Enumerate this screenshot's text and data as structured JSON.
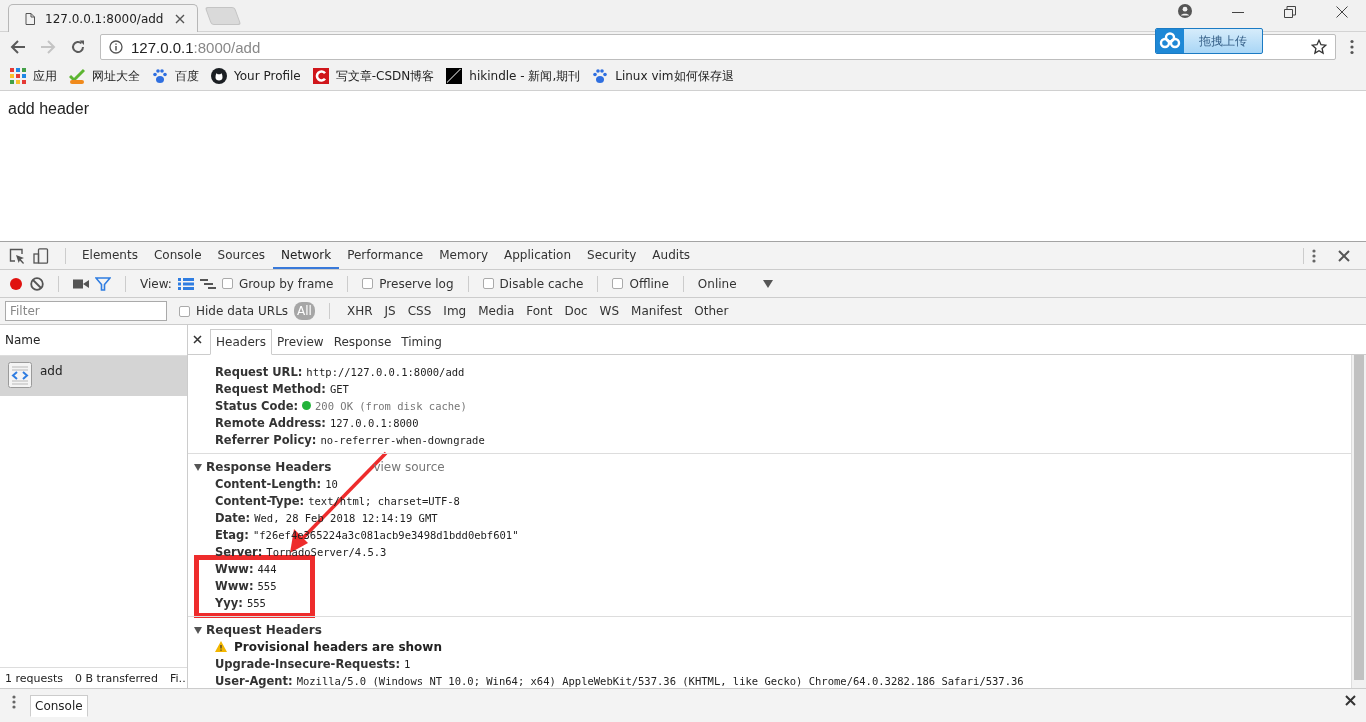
{
  "browser": {
    "tabs": [
      {
        "title": "127.0.0.1:8000/add",
        "selected": true
      }
    ],
    "address": {
      "host": "127.0.0.1",
      "path": ":8000/add"
    },
    "extension_button": "拖拽上传",
    "bookmarks": [
      {
        "label": "应用",
        "kind": "apps"
      },
      {
        "label": "网址大全",
        "kind": "check"
      },
      {
        "label": "百度",
        "kind": "paw"
      },
      {
        "label": "Your Profile",
        "kind": "cat"
      },
      {
        "label": "写文章-CSDN博客",
        "kind": "c"
      },
      {
        "label": "hikindle - 新闻,期刊",
        "kind": "split"
      },
      {
        "label": "Linux vim如何保存退",
        "kind": "paw"
      }
    ]
  },
  "page": {
    "text": "add header"
  },
  "devtools": {
    "tabs": [
      {
        "label": "Elements",
        "selected": false
      },
      {
        "label": "Console",
        "selected": false
      },
      {
        "label": "Sources",
        "selected": false
      },
      {
        "label": "Network",
        "selected": true
      },
      {
        "label": "Performance",
        "selected": false
      },
      {
        "label": "Memory",
        "selected": false
      },
      {
        "label": "Application",
        "selected": false
      },
      {
        "label": "Security",
        "selected": false
      },
      {
        "label": "Audits",
        "selected": false
      }
    ],
    "toolbar": {
      "recording": true,
      "filter_on": true,
      "view_label": "View:",
      "checkboxes": [
        {
          "label": "Group by frame",
          "checked": false
        },
        {
          "label": "Preserve log",
          "checked": false
        },
        {
          "label": "Disable cache",
          "checked": false
        },
        {
          "label": "Offline",
          "checked": false
        }
      ],
      "throttle": "Online"
    },
    "filter": {
      "placeholder": "Filter",
      "hide_data_urls": {
        "label": "Hide data URLs",
        "checked": false
      },
      "types": [
        {
          "label": "All",
          "selected": true
        },
        {
          "label": "XHR",
          "selected": false
        },
        {
          "label": "JS",
          "selected": false
        },
        {
          "label": "CSS",
          "selected": false
        },
        {
          "label": "Img",
          "selected": false
        },
        {
          "label": "Media",
          "selected": false
        },
        {
          "label": "Font",
          "selected": false
        },
        {
          "label": "Doc",
          "selected": false
        },
        {
          "label": "WS",
          "selected": false
        },
        {
          "label": "Manifest",
          "selected": false
        },
        {
          "label": "Other",
          "selected": false
        }
      ]
    },
    "requests": {
      "header": "Name",
      "rows": [
        {
          "name": "add",
          "selected": true
        }
      ],
      "status": [
        "1 requests",
        "0 B transferred",
        "Fi…"
      ]
    },
    "detail": {
      "tabs": [
        {
          "label": "Headers",
          "selected": true
        },
        {
          "label": "Preview",
          "selected": false
        },
        {
          "label": "Response",
          "selected": false
        },
        {
          "label": "Timing",
          "selected": false
        }
      ],
      "sections": [
        {
          "rows": [
            {
              "name": "Request URL:",
              "value": "http://127.0.0.1:8000/add"
            },
            {
              "name": "Request Method:",
              "value": "GET"
            },
            {
              "name": "Status Code:",
              "value": "200 OK (from disk cache)",
              "kind": "status"
            },
            {
              "name": "Remote Address:",
              "value": "127.0.0.1:8000"
            },
            {
              "name": "Referrer Policy:",
              "value": "no-referrer-when-downgrade"
            }
          ]
        },
        {
          "title": "Response Headers",
          "expanded": true,
          "link": "view source",
          "rows": [
            {
              "name": "Content-Length:",
              "value": "10"
            },
            {
              "name": "Content-Type:",
              "value": "text/html; charset=UTF-8"
            },
            {
              "name": "Date:",
              "value": "Wed, 28 Feb 2018 12:14:19 GMT"
            },
            {
              "name": "Etag:",
              "value": "\"f26ef4e365224a3c081acb9e3498d1bdd0ebf601\""
            },
            {
              "name": "Server:",
              "value": "TornadoServer/4.5.3"
            },
            {
              "name": "Www:",
              "value": "444"
            },
            {
              "name": "Www:",
              "value": "555"
            },
            {
              "name": "Yyy:",
              "value": "555"
            }
          ]
        },
        {
          "title": "Request Headers",
          "expanded": true,
          "warning": "Provisional headers are shown",
          "rows": [
            {
              "name": "Upgrade-Insecure-Requests:",
              "value": "1"
            },
            {
              "name": "User-Agent:",
              "value": "Mozilla/5.0 (Windows NT 10.0; Win64; x64) AppleWebKit/537.36 (KHTML, like Gecko) Chrome/64.0.3282.186 Safari/537.36"
            }
          ]
        }
      ]
    },
    "annotations": {
      "highlight_box": true,
      "arrow": true
    },
    "drawer": {
      "tabs": [
        {
          "label": "Console",
          "selected": true
        }
      ]
    }
  }
}
